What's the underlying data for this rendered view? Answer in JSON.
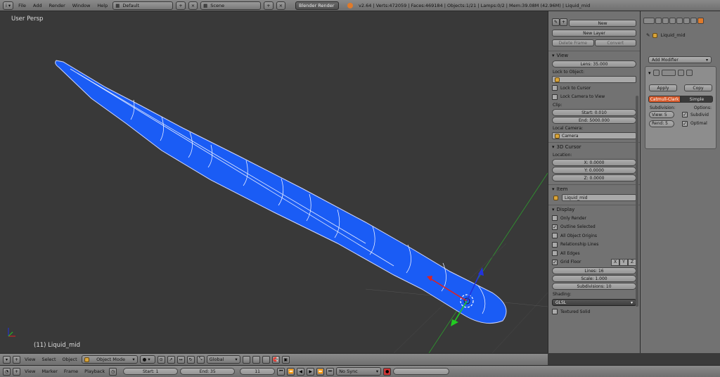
{
  "topbar": {
    "menus": [
      "File",
      "Add",
      "Render",
      "Window",
      "Help"
    ],
    "screen_layout": "Default",
    "scene": "Scene",
    "render_engine": "Blender Render",
    "stats": "v2.64 | Verts:472059 | Faces:469184 | Objects:1/21 | Lamps:0/2 | Mem:39.08M (42.96M) | Liquid_mid"
  },
  "viewport": {
    "label": "User Persp",
    "object_label": "(11) Liquid_mid"
  },
  "npanel": {
    "grease_pencil": {
      "new": "New",
      "new_layer": "New Layer",
      "delete_frame": "Delete Frame",
      "convert": "Convert"
    },
    "view": {
      "title": "View",
      "lens": "Lens: 35.000",
      "lock_to_object": "Lock to Object:",
      "lock_to_cursor": "Lock to Cursor",
      "lock_camera_to_view": "Lock Camera to View",
      "clip": "Clip:",
      "clip_start": "Start: 0.010",
      "clip_end": "End: 5000.000",
      "local_camera": "Local Camera:",
      "camera": "Camera"
    },
    "cursor": {
      "title": "3D Cursor",
      "location": "Location:",
      "x": "X: 0.0000",
      "y": "Y: 0.0000",
      "z": "Z: 0.0000"
    },
    "item": {
      "title": "Item",
      "name": "Liquid_mid"
    },
    "display": {
      "title": "Display",
      "only_render": "Only Render",
      "outline_selected": "Outline Selected",
      "all_object_origins": "All Object Origins",
      "relationship_lines": "Relationship Lines",
      "all_edges": "All Edges",
      "grid_floor": "Grid Floor",
      "x": "X",
      "y": "Y",
      "z": "Z",
      "lines": "Lines: 16",
      "scale": "Scale: 1.000",
      "subdivisions": "Subdivisions: 10",
      "shading": "Shading:",
      "glsl": "GLSL",
      "textured_solid": "Textured Solid"
    }
  },
  "props": {
    "object_name": "Liquid_mid",
    "add_modifier": "Add Modifier",
    "apply": "Apply",
    "copy": "Copy",
    "catmull": "Catmull-Clark",
    "simple": "Simple",
    "subdivisions": "Subdivision:",
    "options": "Options:",
    "view": "View: 5",
    "render": "Rend: 5",
    "subdivide_uvs": "Subdivid",
    "optimal": "Optimal"
  },
  "bottombar": {
    "view": "View",
    "select": "Select",
    "object": "Object",
    "mode": "Object Mode",
    "orientation": "Global"
  },
  "timeline": {
    "view": "View",
    "marker": "Marker",
    "frame": "Frame",
    "playback": "Playback",
    "start": "Start: 1",
    "end": "End: 35",
    "current": "11",
    "sync": "No Sync"
  },
  "colors": {
    "mesh": "#1a5cf5",
    "accent": "#e07a2a"
  }
}
